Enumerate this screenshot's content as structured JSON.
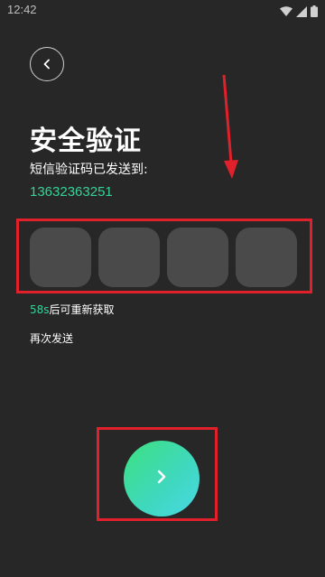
{
  "status_bar": {
    "time": "12:42",
    "icons": [
      "wifi-icon",
      "cellular-signal-icon",
      "battery-icon"
    ]
  },
  "header": {
    "back_icon": "chevron-left-icon"
  },
  "main": {
    "title": "安全验证",
    "sms_hint": "短信验证码已发送到:",
    "phone_number": "13632363251",
    "code_box_count": 4,
    "countdown_seconds": "58s",
    "countdown_suffix": "后可重新获取",
    "resend_label": "再次发送"
  },
  "submit": {
    "icon": "chevron-right-icon"
  },
  "colors": {
    "background": "#272727",
    "accent_green": "#34d399",
    "code_box": "#4a4a4a",
    "annotation_red": "#e0202a",
    "button_gradient_start": "#3ee07f",
    "button_gradient_end": "#49d7e6"
  }
}
